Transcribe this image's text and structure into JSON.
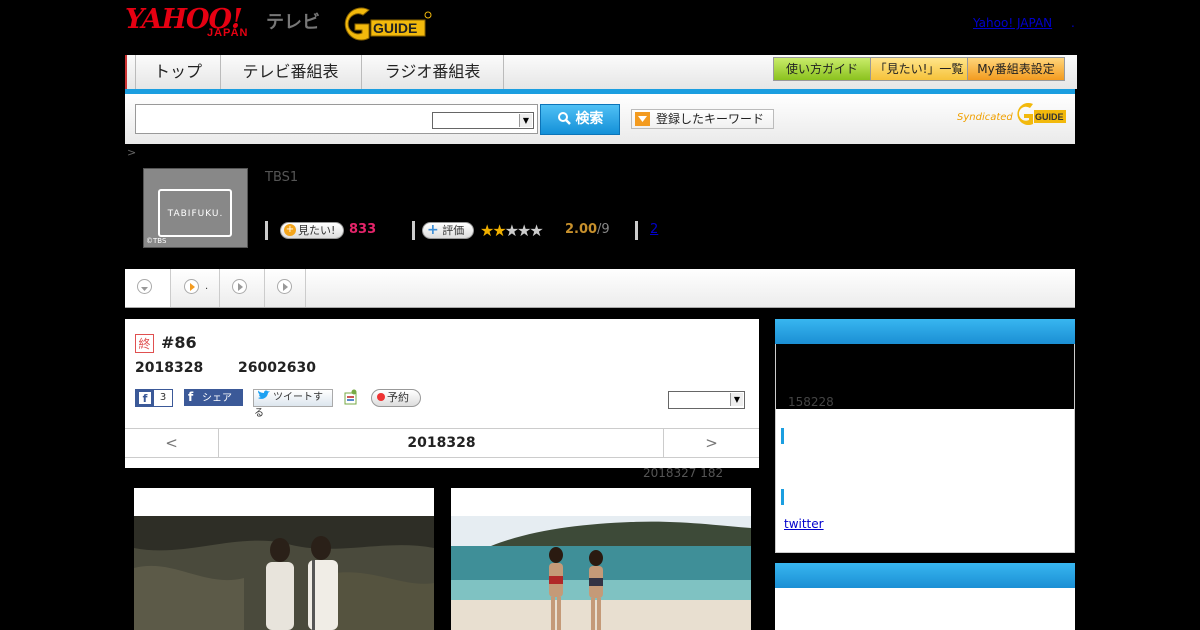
{
  "header": {
    "yahoo_logo": "YAHOO!",
    "japan_label": "JAPAN",
    "tv_label": "テレビ",
    "yahoo_japan_link": "Yahoo! JAPAN",
    "link_separator": "."
  },
  "nav": {
    "tabs": [
      {
        "label": "トップ"
      },
      {
        "label": "テレビ番組表"
      },
      {
        "label": "ラジオ番組表"
      }
    ],
    "right_buttons": [
      {
        "label": "使い方ガイド"
      },
      {
        "label": "「見たい!」一覧"
      },
      {
        "label": "My番組表設定"
      }
    ]
  },
  "search": {
    "query": "",
    "select_value": "",
    "button_label": "検索",
    "keyword_button_label": "登録したキーワード",
    "syndicated_label": "Syndicated"
  },
  "breadcrumb": ">",
  "program": {
    "thumbnail_text": "TABIFUKU.",
    "thumbnail_corner": "©TBS",
    "channel": "TBS1",
    "want_label": "見たい!",
    "want_count": "833",
    "rate_label": "評価",
    "rating_value": 2,
    "rating_max": 5,
    "rating_text": "2.00",
    "rating_suffix": "/9",
    "review_count": "2"
  },
  "subtabs": [
    {
      "label": ""
    },
    {
      "label": "."
    },
    {
      "label": ""
    },
    {
      "label": ""
    }
  ],
  "episode": {
    "end_badge": "終",
    "title": "#86",
    "date": "2018328",
    "time": "26002630",
    "fb_count": "3",
    "fb_share_label": "シェア",
    "tweet_label": "ツイートする",
    "reserve_label": "予約",
    "pager_prev": "<",
    "pager_date": "2018328",
    "pager_next": ">",
    "note": "2018327  182"
  },
  "right_column": {
    "text": "158228",
    "twitter_link": "twitter"
  },
  "colors": {
    "brand_red": "#e60012",
    "accent_blue": "#1b9ee0",
    "want_pink": "#e5246a",
    "rating_gold": "#c7902c"
  }
}
